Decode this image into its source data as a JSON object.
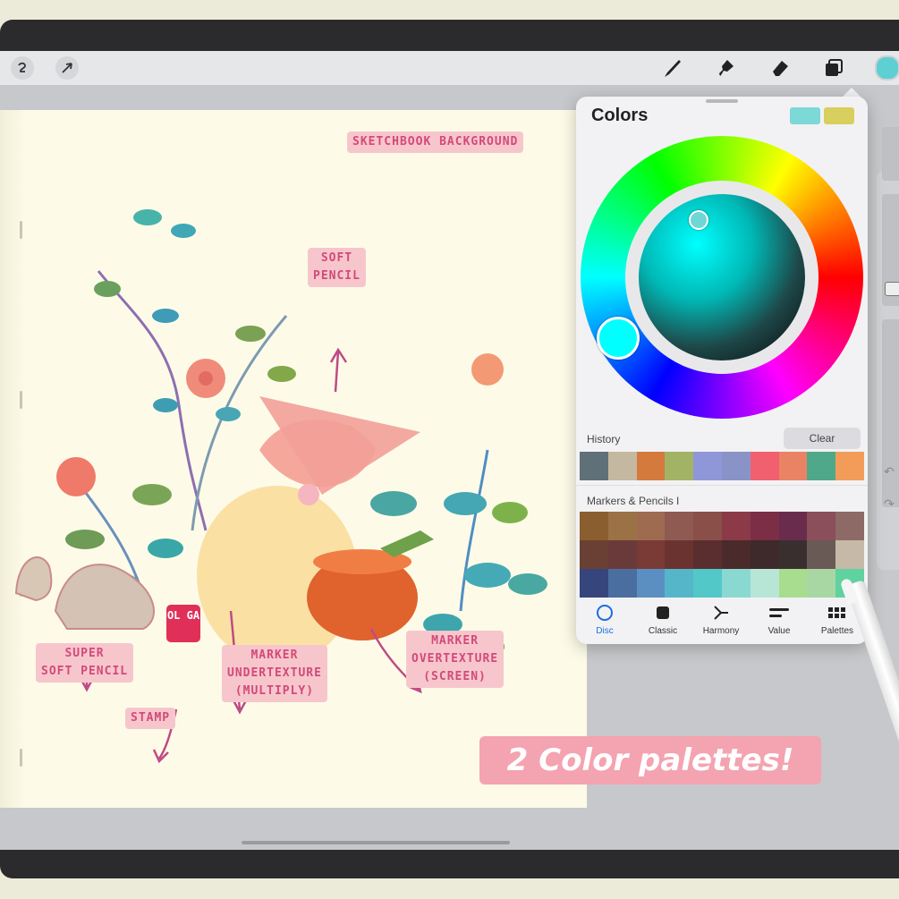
{
  "colors_panel": {
    "title": "Colors",
    "current_color_primary": "#7dd8d8",
    "current_color_secondary": "#d8cf5e",
    "selected_color": "#00ffff",
    "history": {
      "label": "History",
      "clear_label": "Clear",
      "swatches": [
        "#5f7079",
        "#c5b8a1",
        "#d47a3d",
        "#a3b366",
        "#8f97d8",
        "#8a93c8",
        "#f1606f",
        "#e98364",
        "#4fa88a",
        "#f39c5a"
      ]
    },
    "palette": {
      "name": "Markers & Pencils I",
      "rows": [
        [
          "#8a5e2e",
          "#9b7246",
          "#9e6a50",
          "#8e5a52",
          "#8b4f4a",
          "#8c3a47",
          "#7b2e46",
          "#6a2c4c",
          "#8a4f5a",
          "#8e6a66"
        ],
        [
          "#6b4034",
          "#6a3a3a",
          "#7a3a36",
          "#6a3330",
          "#5a2e2e",
          "#4a2a2a",
          "#3e2a2a",
          "#3a2f2f",
          "#6a5a55",
          "#c7b9a7"
        ],
        [
          "#37457d",
          "#4a6ea0",
          "#5b8fc2",
          "#56b6c9",
          "#52c8c8",
          "#8ad8d2",
          "#b8e6d6",
          "#a8dc8e",
          "#a9d7a4",
          "#5fd2a0"
        ]
      ]
    },
    "tabs": [
      {
        "label": "Disc",
        "icon": "disc-icon",
        "active": true
      },
      {
        "label": "Classic",
        "icon": "classic-square-icon",
        "active": false
      },
      {
        "label": "Harmony",
        "icon": "harmony-icon",
        "active": false
      },
      {
        "label": "Value",
        "icon": "value-sliders-icon",
        "active": false
      },
      {
        "label": "Palettes",
        "icon": "palettes-grid-icon",
        "active": false
      }
    ]
  },
  "toolbar": {
    "left_tools": [
      "adjustments-icon",
      "selection-arrow-icon"
    ],
    "right_tools": [
      "brush-icon",
      "smudge-icon",
      "eraser-icon",
      "layers-icon"
    ],
    "active_color": "#5ecfd3"
  },
  "artwork": {
    "labels": {
      "sketchbook_background": "SKETCHBOOK BACKGROUND",
      "soft_pencil": "SOFT\nPENCIL",
      "super_soft_pencil": "SUPER\nSOFT PENCIL",
      "stamp": "STAMP",
      "marker_undertexture": "MARKER\nUNDERTEXTURE\n(MULTIPLY)",
      "marker_overtexture": "MARKER\nOVERTEXTURE\n(SCREEN)",
      "stamp_mark": "OL\nGA"
    },
    "promo_banner": "2 Color palettes!"
  }
}
